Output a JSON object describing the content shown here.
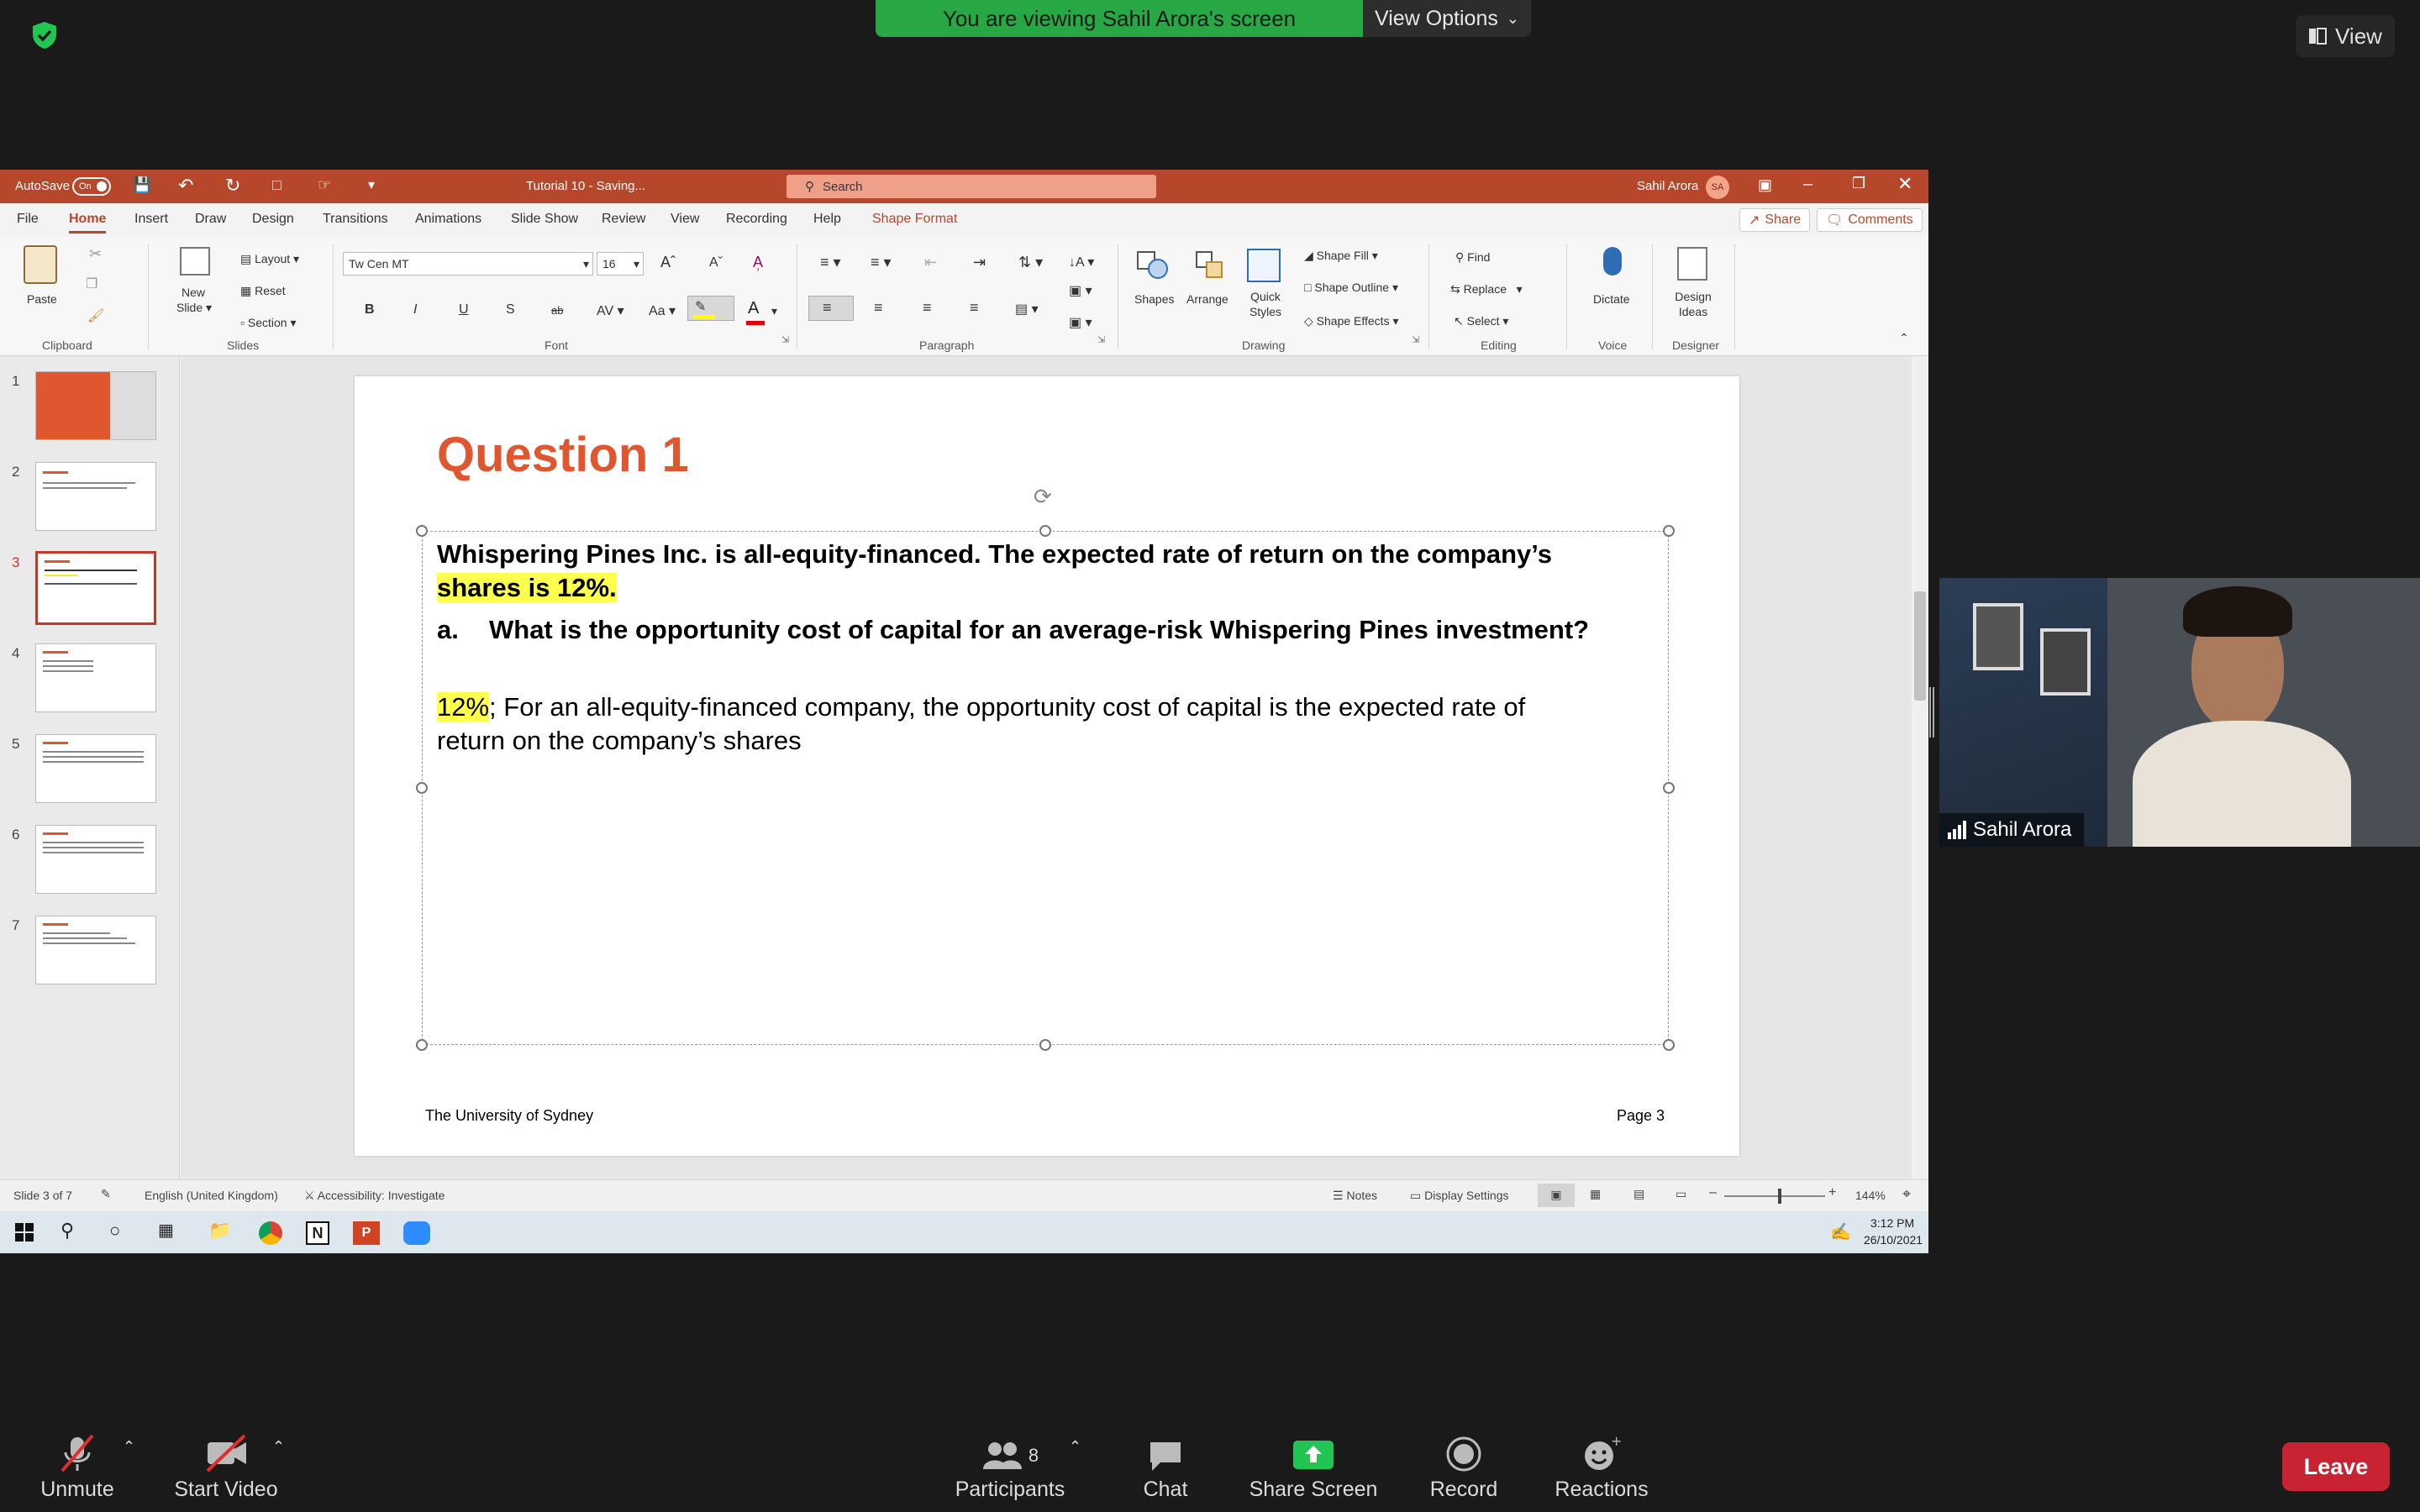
{
  "zoom": {
    "viewing_banner": "You are viewing Sahil Arora's screen",
    "view_options": "View Options",
    "view_button": "View",
    "participant_name": "Sahil Arora",
    "participant_count": "8",
    "toolbar": {
      "unmute": "Unmute",
      "start_video": "Start Video",
      "participants": "Participants",
      "chat": "Chat",
      "share_screen": "Share Screen",
      "record": "Record",
      "reactions": "Reactions",
      "leave": "Leave"
    },
    "colors": {
      "banner": "#28a745",
      "leave": "#c82333",
      "share": "#23c552"
    }
  },
  "ppt": {
    "titlebar": {
      "autosave": "AutoSave",
      "autosave_state": "On",
      "doc_title": "Tutorial 10 - Saving...",
      "search_placeholder": "Search",
      "user_name": "Sahil Arora",
      "user_initials": "SA"
    },
    "tabs": [
      "File",
      "Home",
      "Insert",
      "Draw",
      "Design",
      "Transitions",
      "Animations",
      "Slide Show",
      "Review",
      "View",
      "Recording",
      "Help",
      "Shape Format"
    ],
    "share": "Share",
    "comments": "Comments",
    "ribbon": {
      "paste": "Paste",
      "clipboard": "Clipboard",
      "new_slide": "New\nSlide",
      "layout": "Layout",
      "reset": "Reset",
      "section": "Section",
      "slides": "Slides",
      "font_name": "Tw Cen MT",
      "font_size": "16",
      "font": "Font",
      "paragraph": "Paragraph",
      "shapes": "Shapes",
      "arrange": "Arrange",
      "quick_styles": "Quick Styles",
      "shape_fill": "Shape Fill",
      "shape_outline": "Shape Outline",
      "shape_effects": "Shape Effects",
      "drawing": "Drawing",
      "find": "Find",
      "replace": "Replace",
      "select": "Select",
      "editing": "Editing",
      "dictate": "Dictate",
      "voice": "Voice",
      "design_ideas": "Design Ideas",
      "designer": "Designer",
      "bold": "B",
      "italic": "I",
      "underline": "U",
      "shadow": "S",
      "strike": "ab"
    },
    "slide_numbers": [
      "1",
      "2",
      "3",
      "4",
      "5",
      "6",
      "7"
    ],
    "selected_slide": 3,
    "slide": {
      "title": "Question 1",
      "line1": "Whispering Pines Inc. is all-equity-financed. The expected rate of return on the company’s",
      "line2_highlight": "shares is 12%.",
      "question_label": "a.",
      "question_text": "What is the opportunity cost of capital for an average-risk Whispering Pines investment?",
      "answer_highlight": "12%",
      "answer_line1": "; For an all-equity-financed company, the opportunity cost of capital is the expected rate of",
      "answer_line2": "return on the company’s shares",
      "footer_left": "The University of Sydney",
      "footer_right": "Page 3",
      "title_color": "#e0562f",
      "highlight_color": "#ffff4d"
    },
    "statusbar": {
      "slide_info": "Slide 3 of 7",
      "language": "English (United Kingdom)",
      "accessibility": "Accessibility: Investigate",
      "notes": "Notes",
      "display_settings": "Display Settings",
      "zoom_level": "144%"
    },
    "taskbar": {
      "time": "3:12 PM",
      "date": "26/10/2021"
    }
  }
}
